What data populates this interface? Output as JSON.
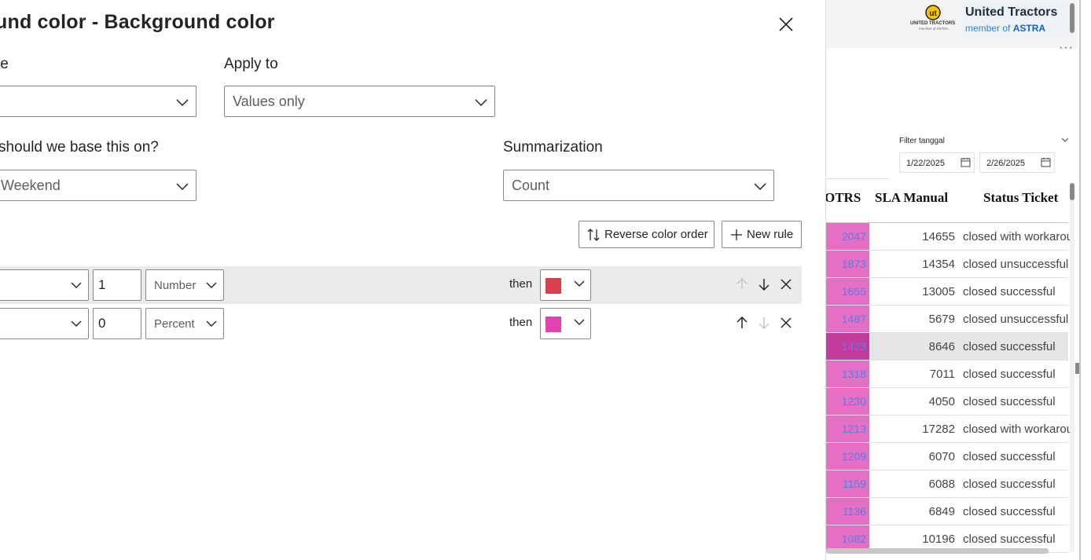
{
  "dialog": {
    "title": "und color - Background color",
    "format_style_label": "le",
    "apply_to": {
      "label": "Apply to",
      "value": "Values only"
    },
    "based_on": {
      "label": "should we base this on?",
      "value": "Weekend"
    },
    "summarization": {
      "label": "Summarization",
      "value": "Count"
    },
    "reverse_button": "Reverse color order",
    "new_rule_button": "New rule",
    "rules": [
      {
        "value": "1",
        "type": "Number",
        "then": "then",
        "color": "#d9414e"
      },
      {
        "value": "0",
        "type": "Percent",
        "then": "then",
        "color": "#e044b0"
      }
    ]
  },
  "report": {
    "logo_caption": "UNITED TRACTORS",
    "logo_subcaption": "member of ASTRA",
    "brand_name": "United Tractors",
    "brand_sub_prefix": "member of",
    "brand_sub_bold": "ASTRA",
    "more": "···",
    "filter": {
      "title": "Filter tanggal",
      "start": "1/22/2025",
      "end": "2/26/2025"
    },
    "table": {
      "headers": [
        "OTRS",
        "SLA Manual",
        "Status Ticket"
      ],
      "rows": [
        {
          "otrs": "2047",
          "sla": "14655",
          "status": "closed with workarou"
        },
        {
          "otrs": "1873",
          "sla": "14354",
          "status": "closed unsuccessful"
        },
        {
          "otrs": "1655",
          "sla": "13005",
          "status": "closed successful"
        },
        {
          "otrs": "1487",
          "sla": "5679",
          "status": "closed unsuccessful"
        },
        {
          "otrs": "1423",
          "sla": "8646",
          "status": "closed successful"
        },
        {
          "otrs": "1318",
          "sla": "7011",
          "status": "closed successful"
        },
        {
          "otrs": "1230",
          "sla": "4050",
          "status": "closed successful"
        },
        {
          "otrs": "1213",
          "sla": "17282",
          "status": "closed with workarou"
        },
        {
          "otrs": "1209",
          "sla": "6070",
          "status": "closed successful"
        },
        {
          "otrs": "1159",
          "sla": "6088",
          "status": "closed successful"
        },
        {
          "otrs": "1136",
          "sla": "6849",
          "status": "closed successful"
        },
        {
          "otrs": "1082",
          "sla": "10196",
          "status": "closed successful"
        }
      ]
    }
  },
  "colors": {
    "otrs_fill": "#e46fc4",
    "otrs_fill_selected": "#c23b9d",
    "selected_row": "#e6e6e6"
  }
}
